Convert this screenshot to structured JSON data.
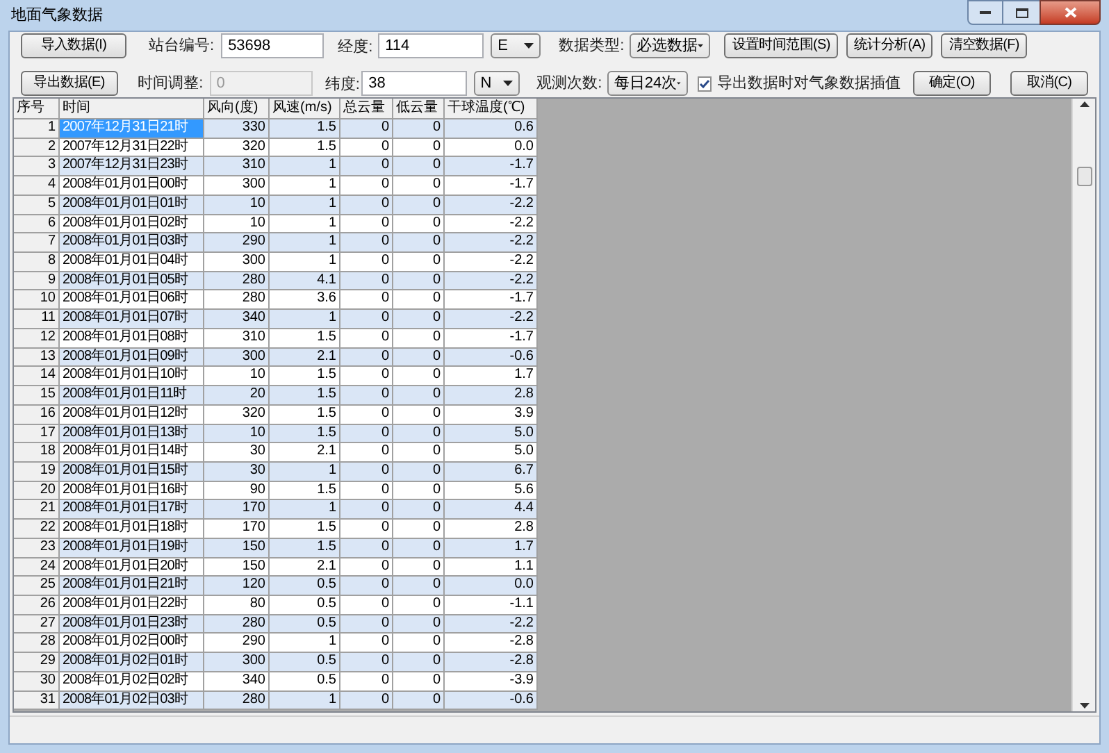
{
  "window": {
    "title": "地面气象数据"
  },
  "toolbar": {
    "import_button": "导入数据(I)",
    "export_button": "导出数据(E)",
    "station": {
      "label": "站台编号:",
      "value": "53698"
    },
    "time_adjust": {
      "label": "时间调整:",
      "value": "0",
      "disabled": true
    },
    "longitude": {
      "label": "经度:",
      "value": "114",
      "hemisphere": "E"
    },
    "latitude": {
      "label": "纬度:",
      "value": "38",
      "hemisphere": "N"
    },
    "data_type": {
      "label": "数据类型:",
      "value": "必选数据"
    },
    "obs_count": {
      "label": "观测次数:",
      "value": "每日24次"
    },
    "interpolate": {
      "label": "导出数据时对气象数据插值",
      "checked": true
    },
    "buttons_top": [
      "设置时间范围(S)",
      "统计分析(A)",
      "清空数据(F)"
    ],
    "buttons_bottom": [
      "确定(O)",
      "取消(C)"
    ]
  },
  "table": {
    "columns": [
      "序号",
      "时间",
      "风向(度)",
      "风速(m/s)",
      "总云量",
      "低云量",
      "干球温度(℃)"
    ],
    "rows": [
      {
        "cells": [
          "1",
          "2007年12月31日21时",
          "330",
          "1.5",
          "0",
          "0",
          "0.6"
        ],
        "selected": true
      },
      {
        "cells": [
          "2",
          "2007年12月31日22时",
          "320",
          "1.5",
          "0",
          "0",
          "0.0"
        ],
        "selected": false
      },
      {
        "cells": [
          "3",
          "2007年12月31日23时",
          "310",
          "1",
          "0",
          "0",
          "-1.7"
        ],
        "selected": false
      },
      {
        "cells": [
          "4",
          "2008年01月01日00时",
          "300",
          "1",
          "0",
          "0",
          "-1.7"
        ],
        "selected": false
      },
      {
        "cells": [
          "5",
          "2008年01月01日01时",
          "10",
          "1",
          "0",
          "0",
          "-2.2"
        ],
        "selected": false
      },
      {
        "cells": [
          "6",
          "2008年01月01日02时",
          "10",
          "1",
          "0",
          "0",
          "-2.2"
        ],
        "selected": false
      },
      {
        "cells": [
          "7",
          "2008年01月01日03时",
          "290",
          "1",
          "0",
          "0",
          "-2.2"
        ],
        "selected": false
      },
      {
        "cells": [
          "8",
          "2008年01月01日04时",
          "300",
          "1",
          "0",
          "0",
          "-2.2"
        ],
        "selected": false
      },
      {
        "cells": [
          "9",
          "2008年01月01日05时",
          "280",
          "4.1",
          "0",
          "0",
          "-2.2"
        ],
        "selected": false
      },
      {
        "cells": [
          "10",
          "2008年01月01日06时",
          "280",
          "3.6",
          "0",
          "0",
          "-1.7"
        ],
        "selected": false
      },
      {
        "cells": [
          "11",
          "2008年01月01日07时",
          "340",
          "1",
          "0",
          "0",
          "-2.2"
        ],
        "selected": false
      },
      {
        "cells": [
          "12",
          "2008年01月01日08时",
          "310",
          "1.5",
          "0",
          "0",
          "-1.7"
        ],
        "selected": false
      },
      {
        "cells": [
          "13",
          "2008年01月01日09时",
          "300",
          "2.1",
          "0",
          "0",
          "-0.6"
        ],
        "selected": false
      },
      {
        "cells": [
          "14",
          "2008年01月01日10时",
          "10",
          "1.5",
          "0",
          "0",
          "1.7"
        ],
        "selected": false
      },
      {
        "cells": [
          "15",
          "2008年01月01日11时",
          "20",
          "1.5",
          "0",
          "0",
          "2.8"
        ],
        "selected": false
      },
      {
        "cells": [
          "16",
          "2008年01月01日12时",
          "320",
          "1.5",
          "0",
          "0",
          "3.9"
        ],
        "selected": false
      },
      {
        "cells": [
          "17",
          "2008年01月01日13时",
          "10",
          "1.5",
          "0",
          "0",
          "5.0"
        ],
        "selected": false
      },
      {
        "cells": [
          "18",
          "2008年01月01日14时",
          "30",
          "2.1",
          "0",
          "0",
          "5.0"
        ],
        "selected": false
      },
      {
        "cells": [
          "19",
          "2008年01月01日15时",
          "30",
          "1",
          "0",
          "0",
          "6.7"
        ],
        "selected": false
      },
      {
        "cells": [
          "20",
          "2008年01月01日16时",
          "90",
          "1.5",
          "0",
          "0",
          "5.6"
        ],
        "selected": false
      },
      {
        "cells": [
          "21",
          "2008年01月01日17时",
          "170",
          "1",
          "0",
          "0",
          "4.4"
        ],
        "selected": false
      },
      {
        "cells": [
          "22",
          "2008年01月01日18时",
          "170",
          "1.5",
          "0",
          "0",
          "2.8"
        ],
        "selected": false
      },
      {
        "cells": [
          "23",
          "2008年01月01日19时",
          "150",
          "1.5",
          "0",
          "0",
          "1.7"
        ],
        "selected": false
      },
      {
        "cells": [
          "24",
          "2008年01月01日20时",
          "150",
          "2.1",
          "0",
          "0",
          "1.1"
        ],
        "selected": false
      },
      {
        "cells": [
          "25",
          "2008年01月01日21时",
          "120",
          "0.5",
          "0",
          "0",
          "0.0"
        ],
        "selected": false
      },
      {
        "cells": [
          "26",
          "2008年01月01日22时",
          "80",
          "0.5",
          "0",
          "0",
          "-1.1"
        ],
        "selected": false
      },
      {
        "cells": [
          "27",
          "2008年01月01日23时",
          "280",
          "0.5",
          "0",
          "0",
          "-2.2"
        ],
        "selected": false
      },
      {
        "cells": [
          "28",
          "2008年01月02日00时",
          "290",
          "1",
          "0",
          "0",
          "-2.8"
        ],
        "selected": false
      },
      {
        "cells": [
          "29",
          "2008年01月02日01时",
          "300",
          "0.5",
          "0",
          "0",
          "-2.8"
        ],
        "selected": false
      },
      {
        "cells": [
          "30",
          "2008年01月02日02时",
          "340",
          "0.5",
          "0",
          "0",
          "-3.9"
        ],
        "selected": false
      },
      {
        "cells": [
          "31",
          "2008年01月02日03时",
          "280",
          "1",
          "0",
          "0",
          "-0.6"
        ],
        "selected": false
      }
    ]
  }
}
